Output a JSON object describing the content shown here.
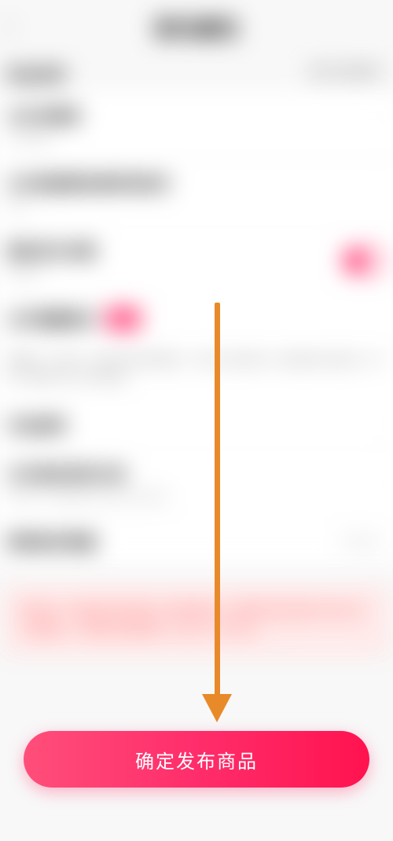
{
  "status": {
    "time": "",
    "carrier": "",
    "battery": ""
  },
  "header": {
    "back": "‹",
    "title": "更改属性"
  },
  "section": {
    "left": "商品规则",
    "right": "展开全部规则 ›"
  },
  "rows": [
    {
      "label": "允许优惠券",
      "sub": "允许使用",
      "chev": "›"
    },
    {
      "label": "允许被搜索和推荐到首页",
      "sub": "允许",
      "chev": "›"
    },
    {
      "label": "提前定价优惠",
      "sub": "已开启",
      "switch": true
    },
    {
      "label": "允许隐藏购买",
      "badge": "新",
      "sub": ""
    }
  ],
  "desc": "提醒您：开启后，商品价格会被隐藏，只有关注店铺的人才能看到价格信息，其他人需要先关注才能查看。",
  "rows2": [
    {
      "label": "开启推荐",
      "sub": "",
      "chev": "›"
    },
    {
      "label": "允许被收录到分类",
      "sub": "已开启，商品会显示在对应分类页",
      "chev": "›"
    },
    {
      "label": "限制购买数量",
      "sub": "",
      "right": "不限制 ›"
    }
  ],
  "notice": "请注意：商品发布后将进入审核流程。审核通过后商品才会正式上架展示，审核时间通常为一至三个工作日。",
  "publish": {
    "label": "确定发布商品"
  }
}
